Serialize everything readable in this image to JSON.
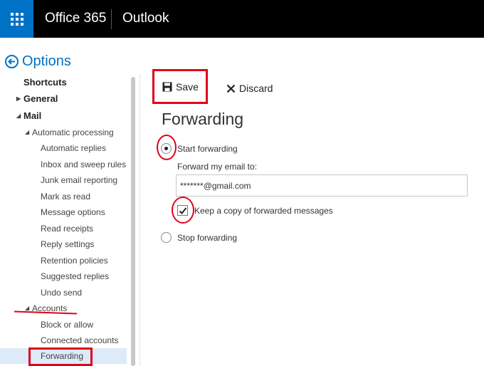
{
  "topbar": {
    "suite_name": "Office 365",
    "app_name": "Outlook"
  },
  "options": {
    "title": "Options"
  },
  "sidebar": {
    "items": [
      {
        "label": "Shortcuts"
      },
      {
        "label": "General"
      },
      {
        "label": "Mail"
      },
      {
        "label": "Automatic processing"
      },
      {
        "label": "Automatic replies"
      },
      {
        "label": "Inbox and sweep rules"
      },
      {
        "label": "Junk email reporting"
      },
      {
        "label": "Mark as read"
      },
      {
        "label": "Message options"
      },
      {
        "label": "Read receipts"
      },
      {
        "label": "Reply settings"
      },
      {
        "label": "Retention policies"
      },
      {
        "label": "Suggested replies"
      },
      {
        "label": "Undo send"
      },
      {
        "label": "Accounts"
      },
      {
        "label": "Block or allow"
      },
      {
        "label": "Connected accounts"
      },
      {
        "label": "Forwarding"
      }
    ],
    "selected": "Forwarding"
  },
  "toolbar": {
    "save_label": "Save",
    "discard_label": "Discard"
  },
  "forwarding": {
    "title": "Forwarding",
    "start_label": "Start forwarding",
    "start_selected": true,
    "forward_to_label": "Forward my email to:",
    "forward_to_value": "*******@gmail.com",
    "keep_copy_label": "Keep a copy of forwarded messages",
    "keep_copy_checked": true,
    "stop_label": "Stop forwarding"
  },
  "colors": {
    "accent": "#0072c6",
    "topbar": "#000000",
    "annotation": "#e0001b",
    "selected_bg": "#dcebf7"
  }
}
